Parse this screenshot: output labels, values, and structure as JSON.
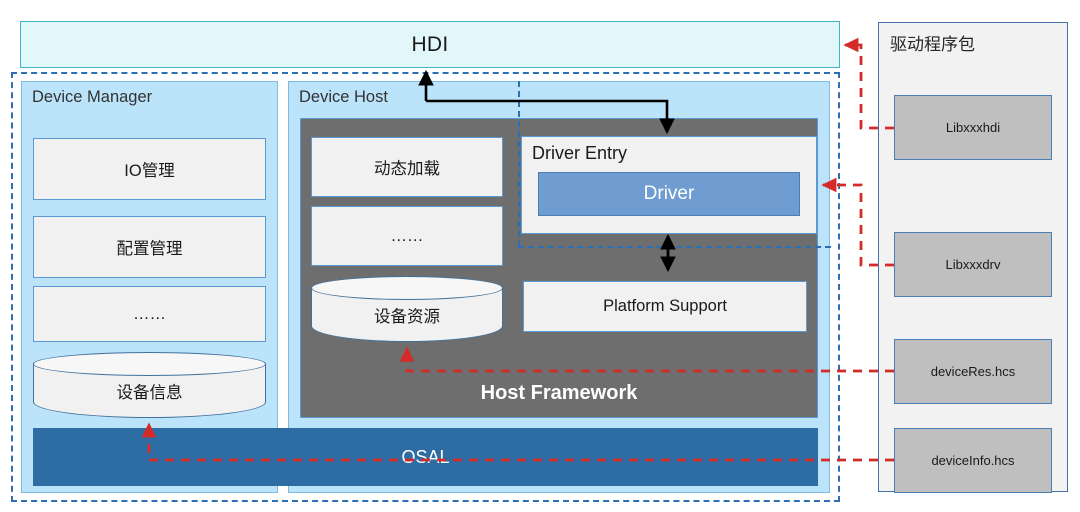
{
  "diagram": {
    "title_hdi": "HDI",
    "panels": {
      "device_manager": {
        "title": "Device Manager",
        "items": [
          {
            "label": "IO管理",
            "shape": "rect"
          },
          {
            "label": "配置管理",
            "shape": "rect"
          },
          {
            "label": "……",
            "shape": "rect"
          },
          {
            "label": "设备信息",
            "shape": "cylinder"
          }
        ]
      },
      "device_host": {
        "title": "Device Host",
        "host_framework": {
          "label": "Host Framework",
          "items": [
            {
              "label": "动态加载",
              "shape": "rect"
            },
            {
              "label": "……",
              "shape": "rect"
            },
            {
              "label": "设备资源",
              "shape": "cylinder"
            },
            {
              "label": "Platform Support",
              "shape": "rect"
            }
          ]
        },
        "driver_entry": {
          "title": "Driver Entry",
          "driver_label": "Driver"
        }
      }
    },
    "osal": "OSAL",
    "driver_package": {
      "title": "驱动程序包",
      "items": [
        {
          "label": "Libxxxhdi"
        },
        {
          "label": "Libxxxdrv"
        },
        {
          "label": "deviceRes.hcs"
        },
        {
          "label": "deviceInfo.hcs"
        }
      ]
    },
    "colors": {
      "hdi_fill": "#e2f7fa",
      "hdi_border": "#41b6c4",
      "panel_fill": "#bbe3fa",
      "panel_border": "#7fb9e0",
      "card_fill": "#f1f1f1",
      "card_border": "#5b9bd5",
      "host_framework_fill": "#6e6e6e",
      "driver_fill": "#6f9dd1",
      "osal_fill": "#2e6da4",
      "package_fill": "#f2f2f2",
      "package_item_fill": "#bfbfbf",
      "dashed_boundary": "#2d6fb5",
      "connector_red": "#d42b28",
      "connector_black": "#000000"
    }
  }
}
